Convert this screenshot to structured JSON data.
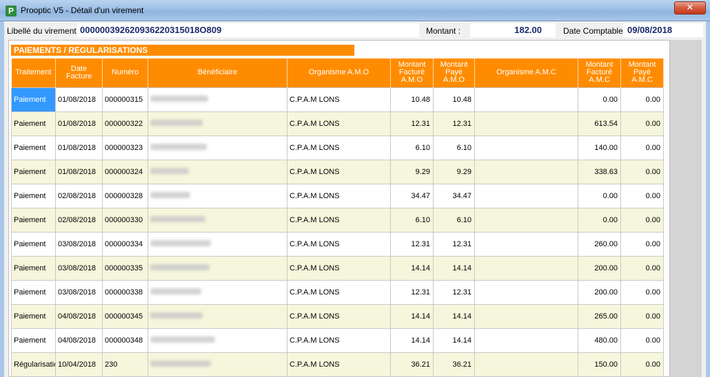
{
  "window": {
    "title": "Prooptic V5 - Détail d'un virement",
    "close_label": "✕",
    "icon_letter": "P"
  },
  "info": {
    "libelle_label": "Libellé du virement :",
    "libelle_value": "000000392620936220315018O809",
    "montant_label": "Montant :",
    "montant_value": "182.00",
    "date_label": "Date Comptable :",
    "date_value": "09/08/2018"
  },
  "section": {
    "title": "PAIEMENTS / REGULARISATIONS"
  },
  "table": {
    "headers": {
      "traitement": "Traitement",
      "date_facture": "Date Facture",
      "numero": "Numéro",
      "beneficiaire": "Bénéficiaire",
      "organisme_amo": "Organisme A.M.O",
      "montant_facture_amo": "Montant Facturé A.M.O",
      "montant_paye_amo": "Montant Payé A.M.O",
      "organisme_amc": "Organisme A.M.C",
      "montant_facture_amc": "Montant Facturé A.M.C",
      "montant_paye_amc": "Montant Payé A.M.C"
    },
    "rows": [
      {
        "traitement": "Paiement",
        "date": "01/08/2018",
        "numero": "000000315",
        "amo": "C.P.A.M LONS",
        "mf_amo": "10.48",
        "mp_amo": "10.48",
        "amc": "",
        "mf_amc": "0.00",
        "mp_amc": "0.00"
      },
      {
        "traitement": "Paiement",
        "date": "01/08/2018",
        "numero": "000000322",
        "amo": "C.P.A.M LONS",
        "mf_amo": "12.31",
        "mp_amo": "12.31",
        "amc": "",
        "mf_amc": "613.54",
        "mp_amc": "0.00"
      },
      {
        "traitement": "Paiement",
        "date": "01/08/2018",
        "numero": "000000323",
        "amo": "C.P.A.M LONS",
        "mf_amo": "6.10",
        "mp_amo": "6.10",
        "amc": "",
        "mf_amc": "140.00",
        "mp_amc": "0.00"
      },
      {
        "traitement": "Paiement",
        "date": "01/08/2018",
        "numero": "000000324",
        "amo": "C.P.A.M LONS",
        "mf_amo": "9.29",
        "mp_amo": "9.29",
        "amc": "",
        "mf_amc": "338.63",
        "mp_amc": "0.00"
      },
      {
        "traitement": "Paiement",
        "date": "02/08/2018",
        "numero": "000000328",
        "amo": "C.P.A.M LONS",
        "mf_amo": "34.47",
        "mp_amo": "34.47",
        "amc": "",
        "mf_amc": "0.00",
        "mp_amc": "0.00"
      },
      {
        "traitement": "Paiement",
        "date": "02/08/2018",
        "numero": "000000330",
        "amo": "C.P.A.M LONS",
        "mf_amo": "6.10",
        "mp_amo": "6.10",
        "amc": "",
        "mf_amc": "0.00",
        "mp_amc": "0.00"
      },
      {
        "traitement": "Paiement",
        "date": "03/08/2018",
        "numero": "000000334",
        "amo": "C.P.A.M LONS",
        "mf_amo": "12.31",
        "mp_amo": "12.31",
        "amc": "",
        "mf_amc": "260.00",
        "mp_amc": "0.00"
      },
      {
        "traitement": "Paiement",
        "date": "03/08/2018",
        "numero": "000000335",
        "amo": "C.P.A.M LONS",
        "mf_amo": "14.14",
        "mp_amo": "14.14",
        "amc": "",
        "mf_amc": "200.00",
        "mp_amc": "0.00"
      },
      {
        "traitement": "Paiement",
        "date": "03/08/2018",
        "numero": "000000338",
        "amo": "C.P.A.M LONS",
        "mf_amo": "12.31",
        "mp_amo": "12.31",
        "amc": "",
        "mf_amc": "200.00",
        "mp_amc": "0.00"
      },
      {
        "traitement": "Paiement",
        "date": "04/08/2018",
        "numero": "000000345",
        "amo": "C.P.A.M LONS",
        "mf_amo": "14.14",
        "mp_amo": "14.14",
        "amc": "",
        "mf_amc": "265.00",
        "mp_amc": "0.00"
      },
      {
        "traitement": "Paiement",
        "date": "04/08/2018",
        "numero": "000000348",
        "amo": "C.P.A.M LONS",
        "mf_amo": "14.14",
        "mp_amo": "14.14",
        "amc": "",
        "mf_amc": "480.00",
        "mp_amc": "0.00"
      },
      {
        "traitement": "Régularisation",
        "date": "10/04/2018",
        "numero": "230",
        "amo": "C.P.A.M LONS",
        "mf_amo": "36.21",
        "mp_amo": "36.21",
        "amc": "",
        "mf_amc": "150.00",
        "mp_amc": "0.00"
      }
    ]
  },
  "colors": {
    "header_orange": "#ff8c00",
    "stripe": "#f6f6dc",
    "selection": "#3399ff",
    "value_text": "#1a2a6c"
  }
}
